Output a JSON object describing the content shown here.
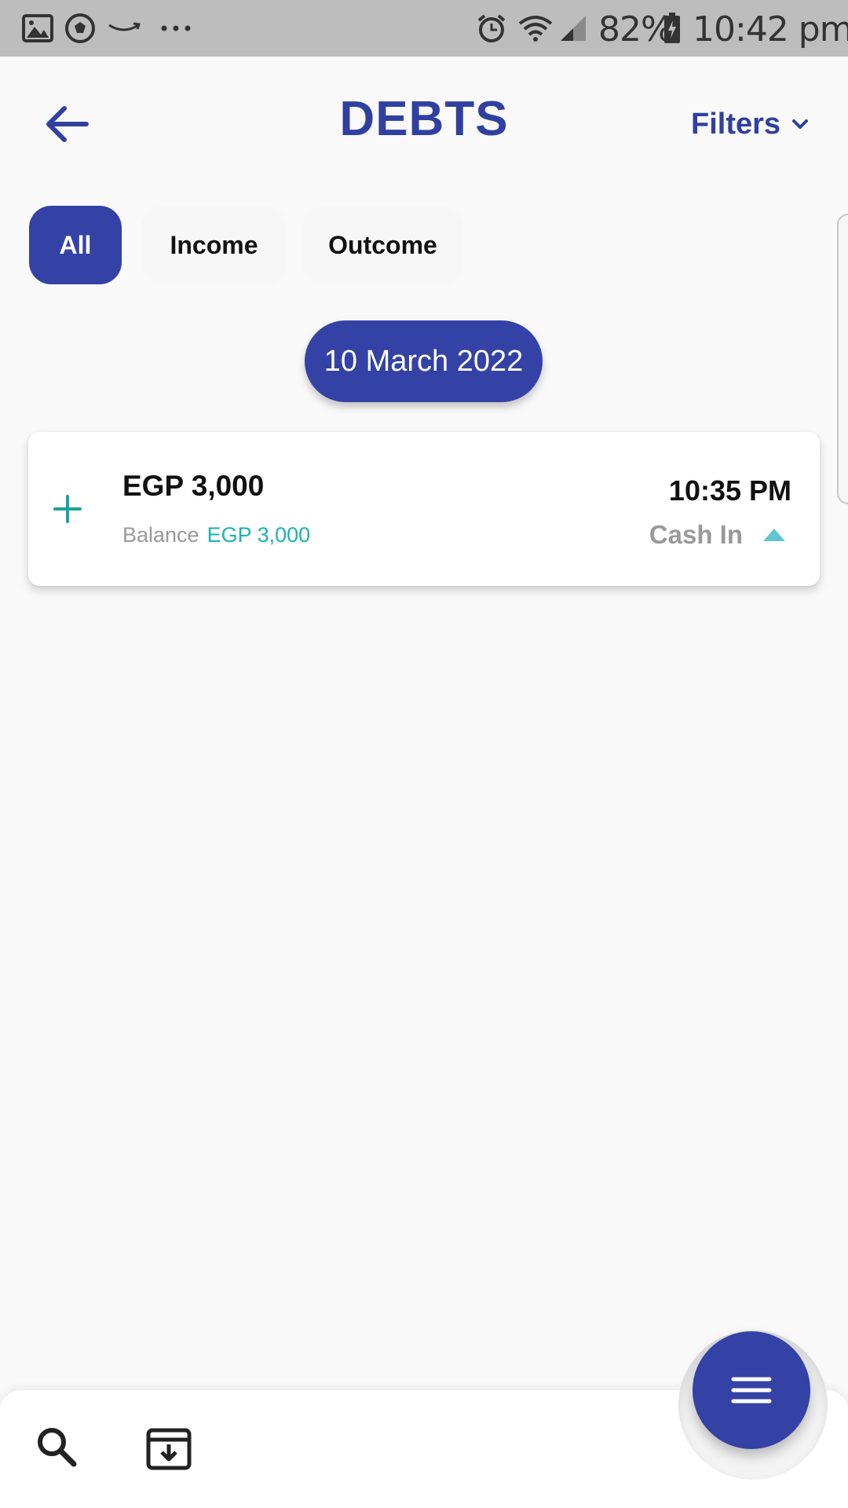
{
  "status_bar": {
    "battery": "82%",
    "time": "10:42 pm"
  },
  "header": {
    "title": "DEBTS",
    "filters_label": "Filters"
  },
  "tabs": [
    {
      "label": "All",
      "active": true
    },
    {
      "label": "Income",
      "active": false
    },
    {
      "label": "Outcome",
      "active": false
    }
  ],
  "date_group": "10 March 2022",
  "transaction": {
    "amount": "EGP 3,000",
    "balance_label": "Balance",
    "balance_value": "EGP 3,000",
    "time": "10:35 PM",
    "type": "Cash In"
  },
  "icons": {
    "back": "arrow-left-icon",
    "filters": "chevron-down-icon",
    "add": "plus-icon",
    "type": "caret-up-icon",
    "search": "search-icon",
    "archive": "archive-icon",
    "menu": "menu-icon"
  },
  "colors": {
    "primary": "#3442a6",
    "accent": "#1ab3b3",
    "muted": "#999999",
    "background": "#f9f9fa"
  }
}
